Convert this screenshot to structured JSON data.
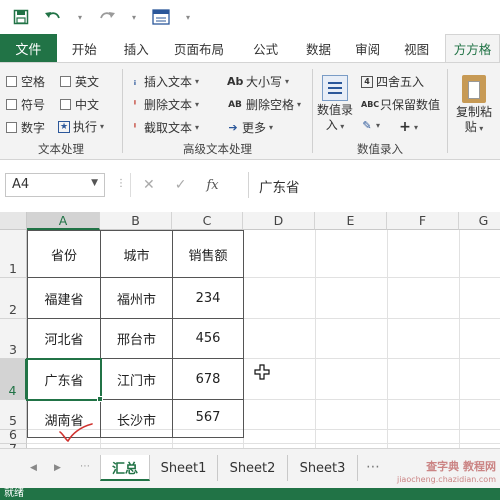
{
  "qat": {
    "save_icon": "save-icon",
    "undo_icon": "undo-icon",
    "redo_icon": "redo-icon",
    "form_icon": "form-icon"
  },
  "tabs": [
    "文件",
    "开始",
    "插入",
    "页面布局",
    "公式",
    "数据",
    "审阅",
    "视图",
    "方方格"
  ],
  "ribbon": {
    "text_processing": {
      "checkboxes": [
        "空格",
        "英文",
        "符号",
        "中文",
        "数字"
      ],
      "execute": "执行",
      "title": "文本处理"
    },
    "advanced": {
      "insert_text": "插入文本",
      "delete_text": "删除文本",
      "cut_text": "截取文本",
      "case": "大小写",
      "delete_space": "删除空格",
      "more": "更多",
      "title": "高级文本处理"
    },
    "numeric": {
      "numeric_entry_line1": "数值录",
      "numeric_entry_line2": "入",
      "round": "四舍五入",
      "keep_numeric": "只保留数值",
      "title": "数值录入"
    },
    "paste": {
      "line1": "复制粘",
      "line2": "贴"
    }
  },
  "formula_bar": {
    "name_box": "A4",
    "cancel": "✕",
    "confirm": "✓",
    "fx": "fx",
    "value": "广东省"
  },
  "grid": {
    "columns": [
      "A",
      "B",
      "C",
      "D",
      "E",
      "F",
      "G"
    ],
    "rows": [
      "1",
      "2",
      "3",
      "4",
      "5",
      "6",
      "7"
    ],
    "header": [
      "省份",
      "城市",
      "销售额"
    ],
    "data": [
      [
        "福建省",
        "福州市",
        "234"
      ],
      [
        "河北省",
        "邢台市",
        "456"
      ],
      [
        "广东省",
        "江门市",
        "678"
      ],
      [
        "湖南省",
        "长沙市",
        "567"
      ]
    ],
    "active_cell": "A4",
    "cursor_icon": "cell-select-cursor-icon",
    "check_icon": "red-checkmark-icon"
  },
  "sheet_tabs": [
    "汇总",
    "Sheet1",
    "Sheet2",
    "Sheet3"
  ],
  "active_sheet": "汇总",
  "status": "就绪",
  "watermark": {
    "line1": "查字典 教程网",
    "line2": "jiaocheng.chazidian.com"
  },
  "colors": {
    "accent": "#217346",
    "ribbon_bg": "#f3f3f3",
    "check": "#d0332f"
  }
}
